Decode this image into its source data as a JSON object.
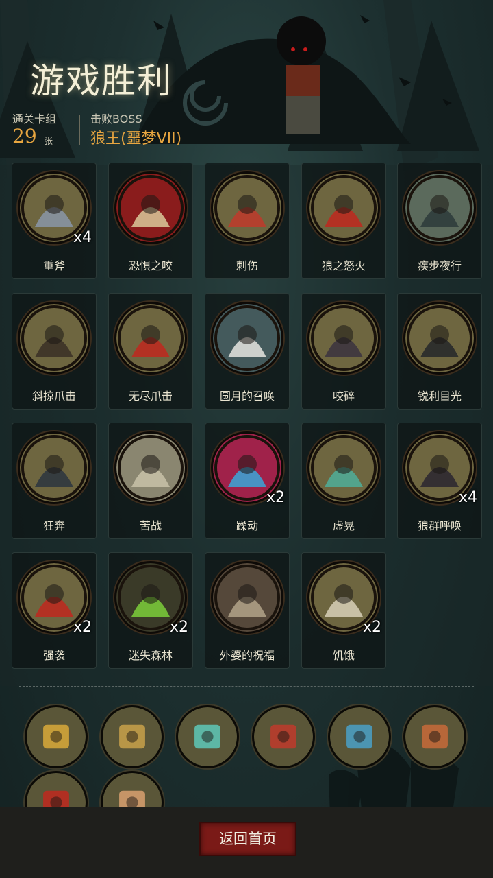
{
  "header": {
    "title": "游戏胜利",
    "deck_label": "通关卡组",
    "deck_count": "29",
    "deck_unit": "张",
    "boss_label": "击败BOSS",
    "boss_name": "狼王(噩梦VII)"
  },
  "cards": [
    {
      "label": "重斧",
      "count": "x4",
      "icon": "axe-icon",
      "bg": "#6e6640",
      "accent": "#8a97a8"
    },
    {
      "label": "恐惧之咬",
      "count": "",
      "icon": "monster-mouth-icon",
      "bg": "#8a1c1c",
      "accent": "#d9c99a"
    },
    {
      "label": "刺伤",
      "count": "",
      "icon": "dagger-icon",
      "bg": "#6e6640",
      "accent": "#c0392b"
    },
    {
      "label": "狼之怒火",
      "count": "",
      "icon": "werewolf-rage-icon",
      "bg": "#6e6640",
      "accent": "#c0281e"
    },
    {
      "label": "疾步夜行",
      "count": "",
      "icon": "wolf-running-icon",
      "bg": "#5b6a5c",
      "accent": "#2d3a3a"
    },
    {
      "label": "斜掠爪击",
      "count": "",
      "icon": "werewolf-leap-icon",
      "bg": "#6e6640",
      "accent": "#3a2f26"
    },
    {
      "label": "无尽爪击",
      "count": "",
      "icon": "claw-slash-icon",
      "bg": "#6e6640",
      "accent": "#c0281e"
    },
    {
      "label": "圆月的召唤",
      "count": "",
      "icon": "full-moon-icon",
      "bg": "#445a5c",
      "accent": "#e6e6e0"
    },
    {
      "label": "咬碎",
      "count": "",
      "icon": "werewolf-bite-icon",
      "bg": "#6e6640",
      "accent": "#3b3340"
    },
    {
      "label": "锐利目光",
      "count": "",
      "icon": "wolf-head-icon",
      "bg": "#6e6640",
      "accent": "#25272a"
    },
    {
      "label": "狂奔",
      "count": "",
      "icon": "wolf-charge-icon",
      "bg": "#6e6640",
      "accent": "#2c3540"
    },
    {
      "label": "苦战",
      "count": "",
      "icon": "knight-fight-icon",
      "bg": "#8a8670",
      "accent": "#c8c2a8"
    },
    {
      "label": "躁动",
      "count": "x2",
      "icon": "magic-burst-icon",
      "bg": "#a0224a",
      "accent": "#3aa7d8"
    },
    {
      "label": "虚晃",
      "count": "",
      "icon": "boxer-icon",
      "bg": "#6e6640",
      "accent": "#4fae9a"
    },
    {
      "label": "狼群呼唤",
      "count": "x4",
      "icon": "wolf-pack-icon",
      "bg": "#6e6640",
      "accent": "#2a2630"
    },
    {
      "label": "强袭",
      "count": "x2",
      "icon": "werewolf-howl-icon",
      "bg": "#6e6640",
      "accent": "#c0281e"
    },
    {
      "label": "迷失森林",
      "count": "x2",
      "icon": "lost-forest-icon",
      "bg": "#3a3a28",
      "accent": "#7ccf3a"
    },
    {
      "label": "外婆的祝福",
      "count": "",
      "icon": "grandma-icon",
      "bg": "#55483a",
      "accent": "#b3a48a"
    },
    {
      "label": "饥饿",
      "count": "x2",
      "icon": "skeleton-icon",
      "bg": "#6e6640",
      "accent": "#d8d0b8"
    }
  ],
  "relics": [
    {
      "icon": "treasure-chest-icon",
      "accent": "#d9a93a"
    },
    {
      "icon": "hourglass-icon",
      "accent": "#c9a14a"
    },
    {
      "icon": "cards-swirl-icon",
      "accent": "#5ec8b8"
    },
    {
      "icon": "dna-helix-icon",
      "accent": "#c0392b"
    },
    {
      "icon": "card-hand-icon",
      "accent": "#4aa0c8"
    },
    {
      "icon": "pirate-captain-icon",
      "accent": "#c86a3a"
    },
    {
      "icon": "red-card-icon",
      "accent": "#c0281e"
    },
    {
      "icon": "smiling-hunter-icon",
      "accent": "#d9a070"
    }
  ],
  "footer": {
    "return_label": "返回首页"
  },
  "colors": {
    "accent_orange": "#e8a640",
    "button_red": "#7a1a17",
    "card_bg": "#0e1616"
  }
}
